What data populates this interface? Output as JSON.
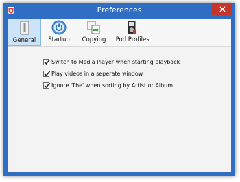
{
  "window": {
    "title": "Preferences",
    "accent_color": "#2f6ec2",
    "close_color": "#c4352b",
    "close_icon": "close-icon",
    "app_icon": "app-logo-icon"
  },
  "toolbar": {
    "active_tab": "General",
    "tabs": [
      {
        "label": "General",
        "icon": "general-icon"
      },
      {
        "label": "Startup",
        "icon": "power-icon"
      },
      {
        "label": "Copying",
        "icon": "copy-icon"
      },
      {
        "label": "iPod Profiles",
        "icon": "ipod-icon"
      }
    ]
  },
  "general": {
    "options": [
      {
        "label": "Switch to Media Player when starting playback",
        "checked": true
      },
      {
        "label": "Play videos in a seperate window",
        "checked": true
      },
      {
        "label": "Ignore 'The' when sorting by Artist or Album",
        "checked": true
      }
    ]
  }
}
